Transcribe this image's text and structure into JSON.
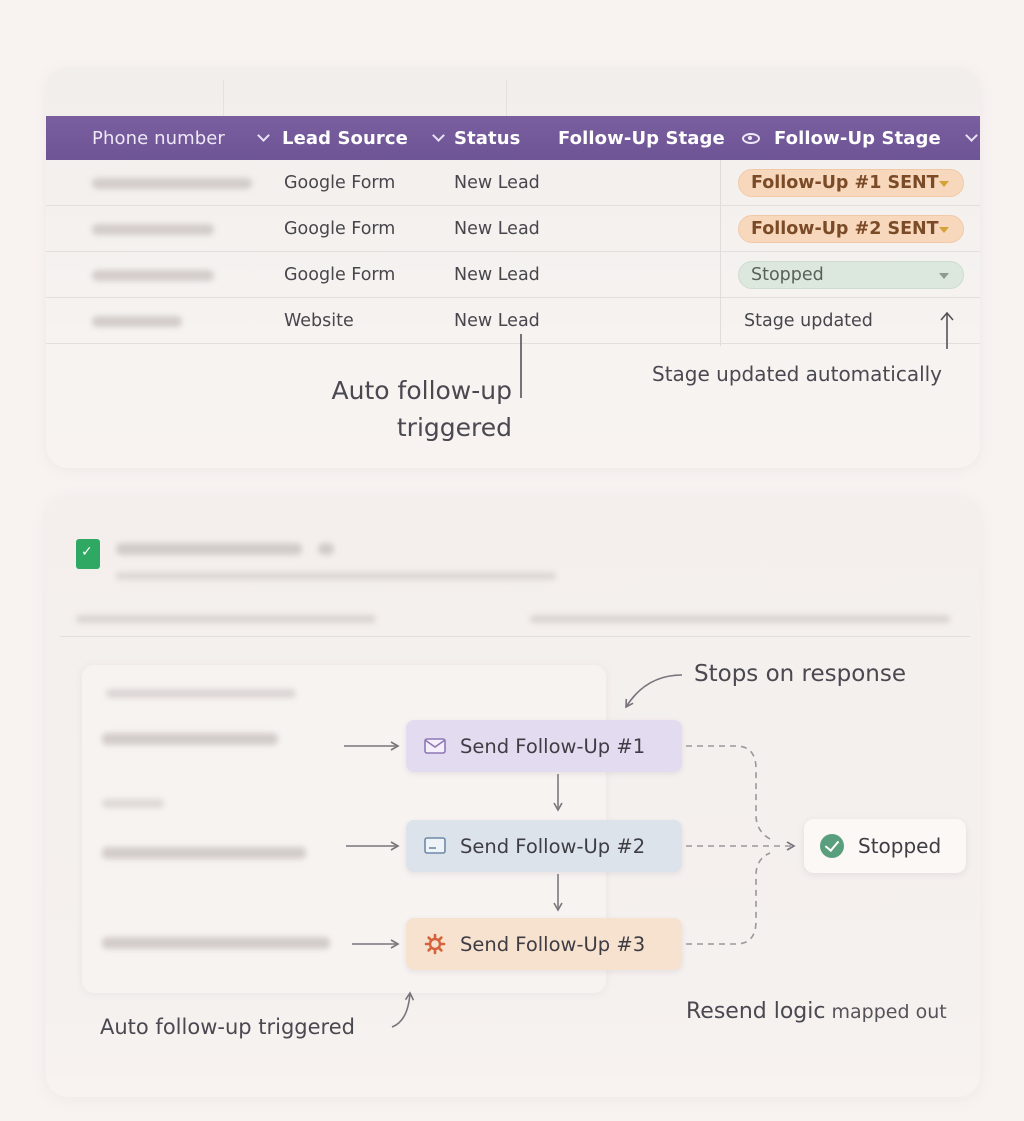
{
  "spreadsheet": {
    "columns": [
      {
        "label": "Phone number",
        "has_chevron": true
      },
      {
        "label": "Lead Source",
        "has_chevron": true
      },
      {
        "label": "Status",
        "has_chevron": false
      },
      {
        "label": "Follow-Up Stage",
        "has_chevron": false
      },
      {
        "label": "Follow-Up Stage",
        "has_chevron": true,
        "icon": "eye-icon"
      }
    ],
    "rows": [
      {
        "lead_source": "Google Form",
        "status": "New Lead",
        "stage": "Follow-Up #1 SENT",
        "stage_style": "orange"
      },
      {
        "lead_source": "Google Form",
        "status": "New Lead",
        "stage": "Follow-Up #2 SENT",
        "stage_style": "orange"
      },
      {
        "lead_source": "Google Form",
        "status": "New Lead",
        "stage": "Stopped",
        "stage_style": "green"
      },
      {
        "lead_source": "Website",
        "status": "New Lead",
        "stage": "Stage updated",
        "stage_style": "plain"
      }
    ],
    "annotation_trigger": "Auto follow-up triggered",
    "annotation_stage": "Stage updated automatically"
  },
  "flow": {
    "boxes": [
      {
        "label": "Send Follow-Up #1",
        "icon": "envelope-icon"
      },
      {
        "label": "Send Follow-Up #2",
        "icon": "screen-icon"
      },
      {
        "label": "Send Follow-Up #3",
        "icon": "gear-icon"
      }
    ],
    "stopped_label": "Stopped",
    "annotation_stops": "Stops on response",
    "annotation_trigger": "Auto follow-up triggered",
    "annotation_resend_bold": "Resend logic",
    "annotation_resend_rest": " mapped out"
  },
  "colors": {
    "header": "#6d5494",
    "pill_orange": "#f8d8bd",
    "pill_green": "#dce8dd",
    "box1": "#e3dbf0",
    "box2": "#dde3ea",
    "box3": "#f6e2cf",
    "check": "#5a9f7d"
  }
}
